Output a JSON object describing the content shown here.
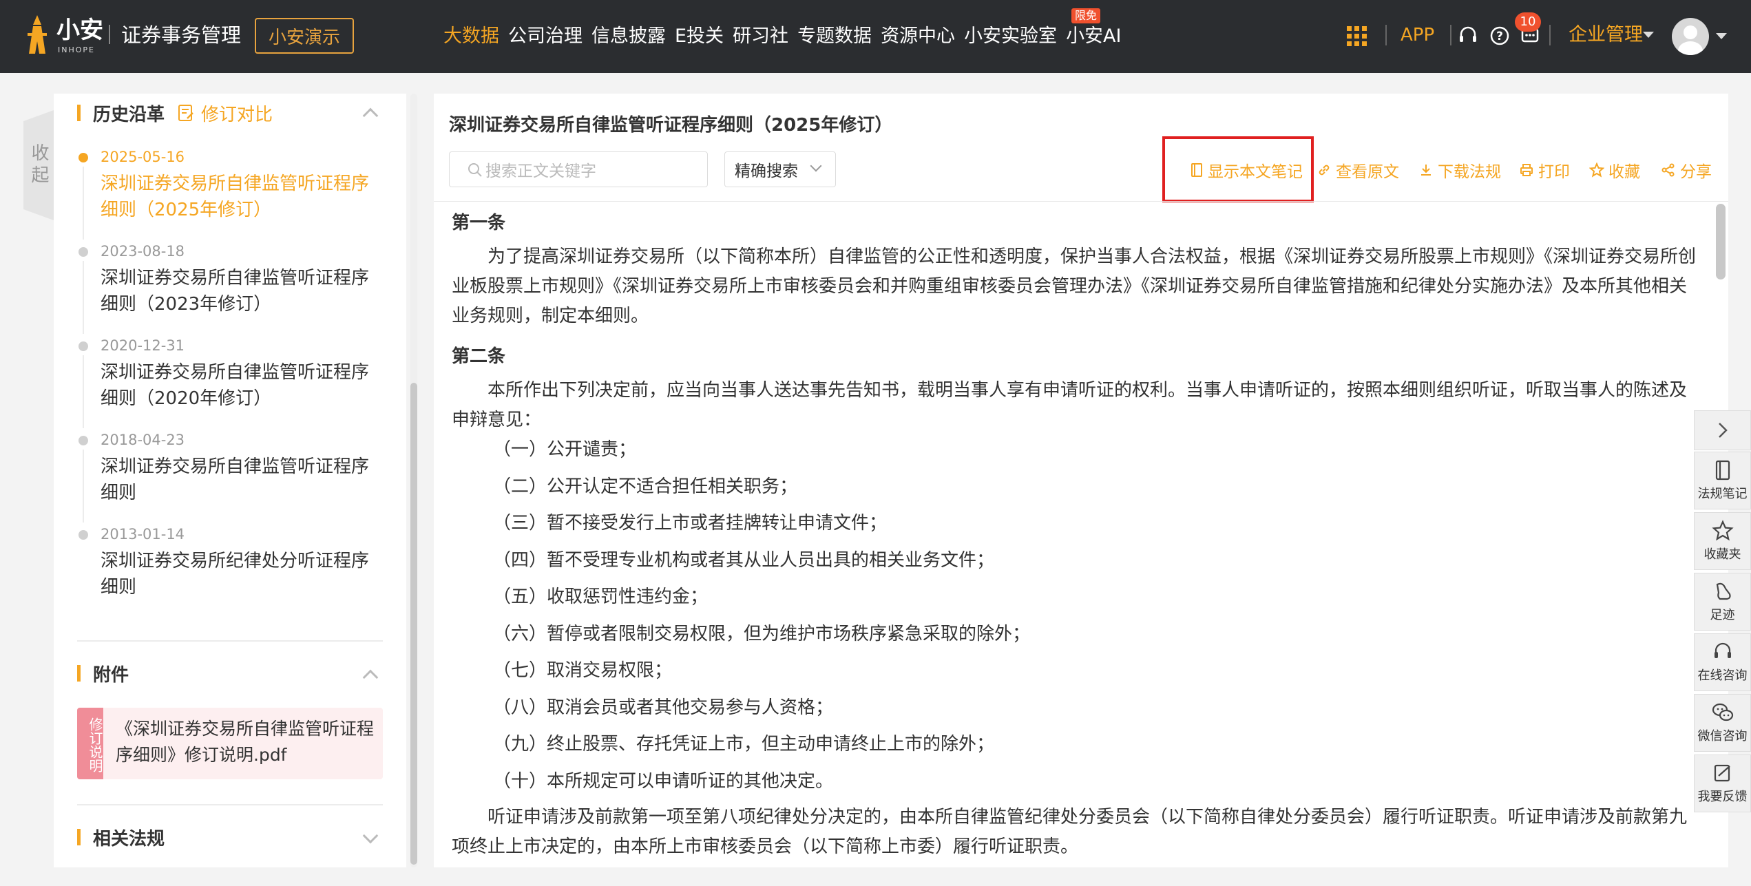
{
  "header": {
    "logo_text": "小安",
    "logo_sub": "INHOPE",
    "app_title": "证券事务管理",
    "demo_label": "小安演示",
    "nav": [
      {
        "label": "大数据",
        "active": true
      },
      {
        "label": "公司治理",
        "active": false
      },
      {
        "label": "信息披露",
        "active": false
      },
      {
        "label": "E投关",
        "active": false
      },
      {
        "label": "研习社",
        "active": false
      },
      {
        "label": "专题数据",
        "active": false
      },
      {
        "label": "资源中心",
        "active": false
      },
      {
        "label": "小安实验室",
        "active": false
      },
      {
        "label": "小安AI",
        "active": false
      }
    ],
    "nav_badge": "限免",
    "app_label": "APP",
    "message_count": "10",
    "org_label": "企业管理",
    "accent_color": "#f5a623"
  },
  "left": {
    "collapse_label": "收起",
    "history_title": "历史沿革",
    "compare_label": "修订对比",
    "timeline": [
      {
        "date": "2025-05-16",
        "title": "深圳证券交易所自律监管听证程序细则（2025年修订）",
        "active": true
      },
      {
        "date": "2023-08-18",
        "title": "深圳证券交易所自律监管听证程序细则（2023年修订）",
        "active": false
      },
      {
        "date": "2020-12-31",
        "title": "深圳证券交易所自律监管听证程序细则（2020年修订）",
        "active": false
      },
      {
        "date": "2018-04-23",
        "title": "深圳证券交易所自律监管听证程序细则",
        "active": false
      },
      {
        "date": "2013-01-14",
        "title": "深圳证券交易所纪律处分听证程序细则",
        "active": false
      }
    ],
    "attachments_title": "附件",
    "attachment": {
      "tag": "修订说明",
      "name": "《深圳证券交易所自律监管听证程序细则》修订说明.pdf"
    },
    "related_title": "相关法规"
  },
  "main": {
    "title": "深圳证券交易所自律监管听证程序细则（2025年修订）",
    "search_placeholder": "搜索正文关键字",
    "search_mode": "精确搜索",
    "tools": {
      "notes": "显示本文笔记",
      "original": "查看原文",
      "download": "下载法规",
      "print": "打印",
      "favorite": "收藏",
      "share": "分享"
    },
    "article1_heading": "第一条",
    "article1_text": "为了提高深圳证券交易所（以下简称本所）自律监管的公正性和透明度，保护当事人合法权益，根据《深圳证券交易所股票上市规则》《深圳证券交易所创业板股票上市规则》《深圳证券交易所上市审核委员会和并购重组审核委员会管理办法》《深圳证券交易所自律监管措施和纪律处分实施办法》及本所其他相关业务规则，制定本细则。",
    "article2_heading": "第二条",
    "article2_intro": "本所作出下列决定前，应当向当事人送达事先告知书，载明当事人享有申请听证的权利。当事人申请听证的，按照本细则组织听证，听取当事人的陈述及申辩意见：",
    "article2_items": [
      "（一）公开谴责；",
      "（二）公开认定不适合担任相关职务；",
      "（三）暂不接受发行上市或者挂牌转让申请文件；",
      "（四）暂不受理专业机构或者其从业人员出具的相关业务文件；",
      "（五）收取惩罚性违约金；",
      "（六）暂停或者限制交易权限，但为维护市场秩序紧急采取的除外；",
      "（七）取消交易权限；",
      "（八）取消会员或者其他交易参与人资格；",
      "（九）终止股票、存托凭证上市，但主动申请终止上市的除外；",
      "（十）本所规定可以申请听证的其他决定。"
    ],
    "article2_tail": "听证申请涉及前款第一项至第八项纪律处分决定的，由本所自律监管纪律处分委员会（以下简称自律处分委员会）履行听证职责。听证申请涉及前款第九项终止上市决定的，由本所上市审核委员会（以下简称上市委）履行听证职责。"
  },
  "side_tools": [
    {
      "label": "法规笔记",
      "icon": "note-icon"
    },
    {
      "label": "收藏夹",
      "icon": "star-icon"
    },
    {
      "label": "足迹",
      "icon": "footprint-icon"
    },
    {
      "label": "在线咨询",
      "icon": "headset-icon"
    },
    {
      "label": "微信咨询",
      "icon": "wechat-icon"
    },
    {
      "label": "我要反馈",
      "icon": "feedback-icon"
    }
  ]
}
